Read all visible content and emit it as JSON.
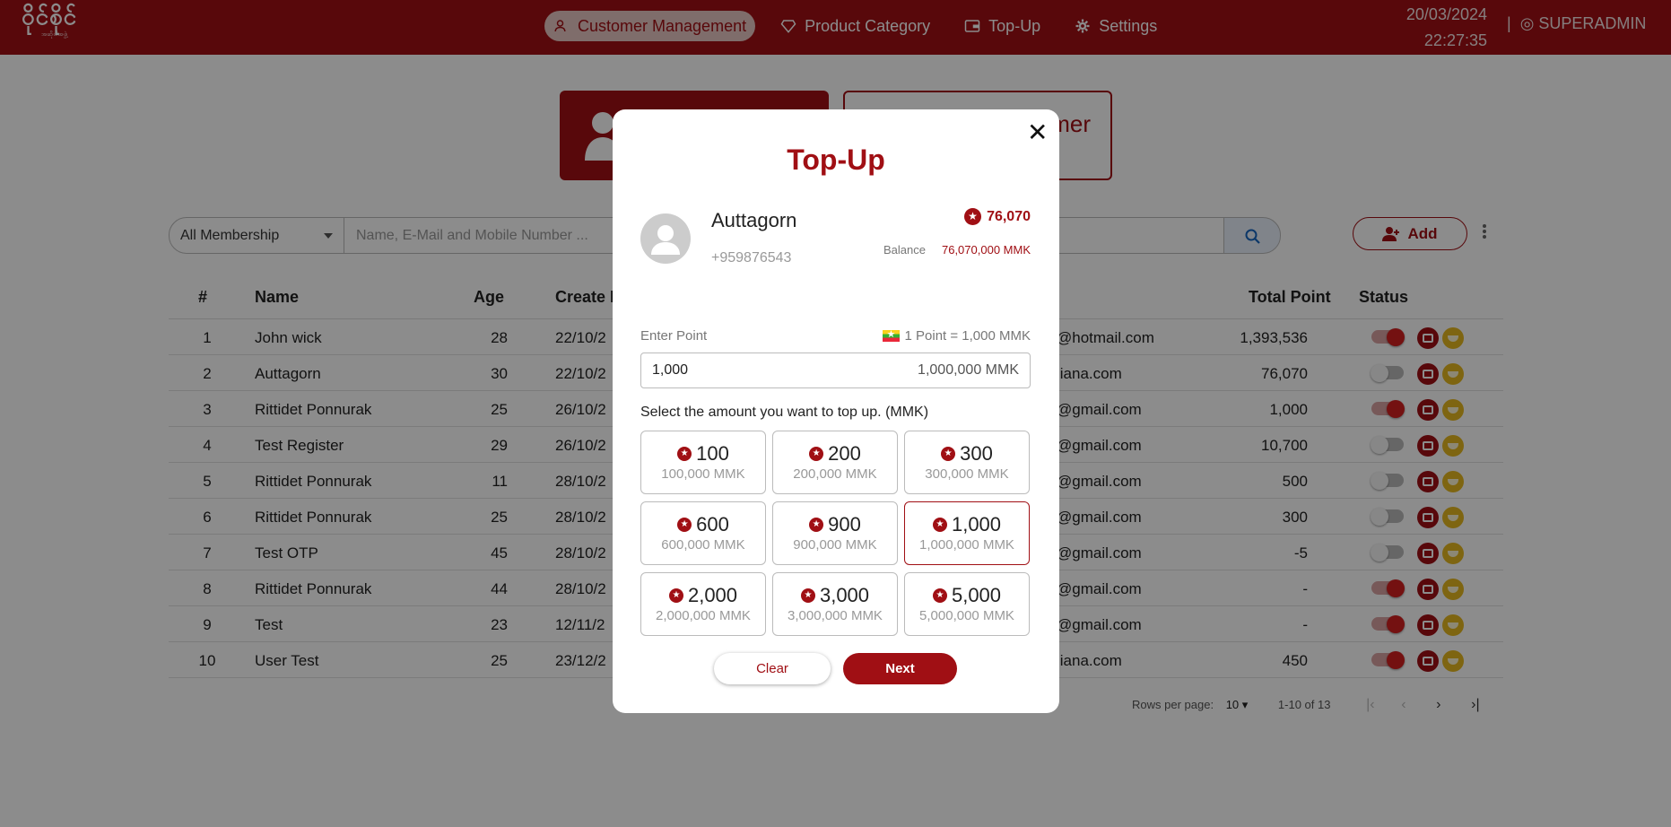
{
  "header": {
    "logo_text": "ဝိုင်စိုင်",
    "logo_sub": "အဆိုပါအဖွဲ့",
    "nav": [
      {
        "label": "Customer Management",
        "icon": "person-icon",
        "active": true
      },
      {
        "label": "Product Category",
        "icon": "diamond-icon",
        "active": false
      },
      {
        "label": "Top-Up",
        "icon": "wallet-icon",
        "active": false
      },
      {
        "label": "Settings",
        "icon": "gear-icon",
        "active": false
      }
    ],
    "date": "20/03/2024",
    "time": "22:27:35",
    "separator": "|",
    "user": "◎ SUPERADMIN"
  },
  "cards": {
    "card2_text": "mer"
  },
  "filters": {
    "membership": "All Membership",
    "search_placeholder": "Name, E-Mail and Mobile Number ...",
    "add_label": "Add"
  },
  "table": {
    "headers": {
      "no": "#",
      "name": "Name",
      "age": "Age",
      "create": "Create D",
      "total": "Total Point",
      "status": "Status"
    },
    "rows": [
      {
        "no": "1",
        "name": "John wick",
        "age": "28",
        "date": "22/10/2",
        "email": "@hotmail.com",
        "points": "1,393,536",
        "active": true
      },
      {
        "no": "2",
        "name": "Auttagorn",
        "age": "30",
        "date": "22/10/2",
        "email": "liana.com",
        "points": "76,070",
        "active": false
      },
      {
        "no": "3",
        "name": "Rittidet Ponnurak",
        "age": "25",
        "date": "26/10/2",
        "email": "@gmail.com",
        "points": "1,000",
        "active": true
      },
      {
        "no": "4",
        "name": "Test Register",
        "age": "29",
        "date": "26/10/2",
        "email": "@gmail.com",
        "points": "10,700",
        "active": false
      },
      {
        "no": "5",
        "name": "Rittidet Ponnurak",
        "age": "11",
        "date": "28/10/2",
        "email": "@gmail.com",
        "points": "500",
        "active": false
      },
      {
        "no": "6",
        "name": "Rittidet Ponnurak",
        "age": "25",
        "date": "28/10/2",
        "email": "@gmail.com",
        "points": "300",
        "active": false
      },
      {
        "no": "7",
        "name": "Test OTP",
        "age": "45",
        "date": "28/10/2",
        "email": "@gmail.com",
        "points": "-5",
        "active": false
      },
      {
        "no": "8",
        "name": "Rittidet Ponnurak",
        "age": "44",
        "date": "28/10/2",
        "email": "@gmail.com",
        "points": "-",
        "active": true
      },
      {
        "no": "9",
        "name": "Test",
        "age": "23",
        "date": "12/11/2",
        "email": "@gmail.com",
        "points": "-",
        "active": true
      },
      {
        "no": "10",
        "name": "User Test",
        "age": "25",
        "date": "23/12/2",
        "email": "liana.com",
        "points": "450",
        "active": true
      }
    ]
  },
  "pager": {
    "rows_label": "Rows per page:",
    "rows_value": "10",
    "range": "1-10 of 13"
  },
  "modal": {
    "close": "✕",
    "title": "Top-Up",
    "name": "Auttagorn",
    "phone": "+959876543",
    "points": "76,070",
    "balance_label": "Balance",
    "balance_value": "76,070,000 MMK",
    "enter_point_label": "Enter Point",
    "rate": "1 Point = 1,000 MMK",
    "input_value": "1,000",
    "input_mmk": "1,000,000 MMK",
    "select_label": "Select the amount you want to top up. (MMK)",
    "options": [
      {
        "points": "100",
        "mmk": "100,000 MMK",
        "selected": false
      },
      {
        "points": "200",
        "mmk": "200,000 MMK",
        "selected": false
      },
      {
        "points": "300",
        "mmk": "300,000 MMK",
        "selected": false
      },
      {
        "points": "600",
        "mmk": "600,000 MMK",
        "selected": false
      },
      {
        "points": "900",
        "mmk": "900,000 MMK",
        "selected": false
      },
      {
        "points": "1,000",
        "mmk": "1,000,000 MMK",
        "selected": true
      },
      {
        "points": "2,000",
        "mmk": "2,000,000 MMK",
        "selected": false
      },
      {
        "points": "3,000",
        "mmk": "3,000,000 MMK",
        "selected": false
      },
      {
        "points": "5,000",
        "mmk": "5,000,000 MMK",
        "selected": false
      }
    ],
    "clear_label": "Clear",
    "next_label": "Next"
  },
  "colors": {
    "brand": "#a00f14",
    "accent_gold": "#e6b820"
  }
}
